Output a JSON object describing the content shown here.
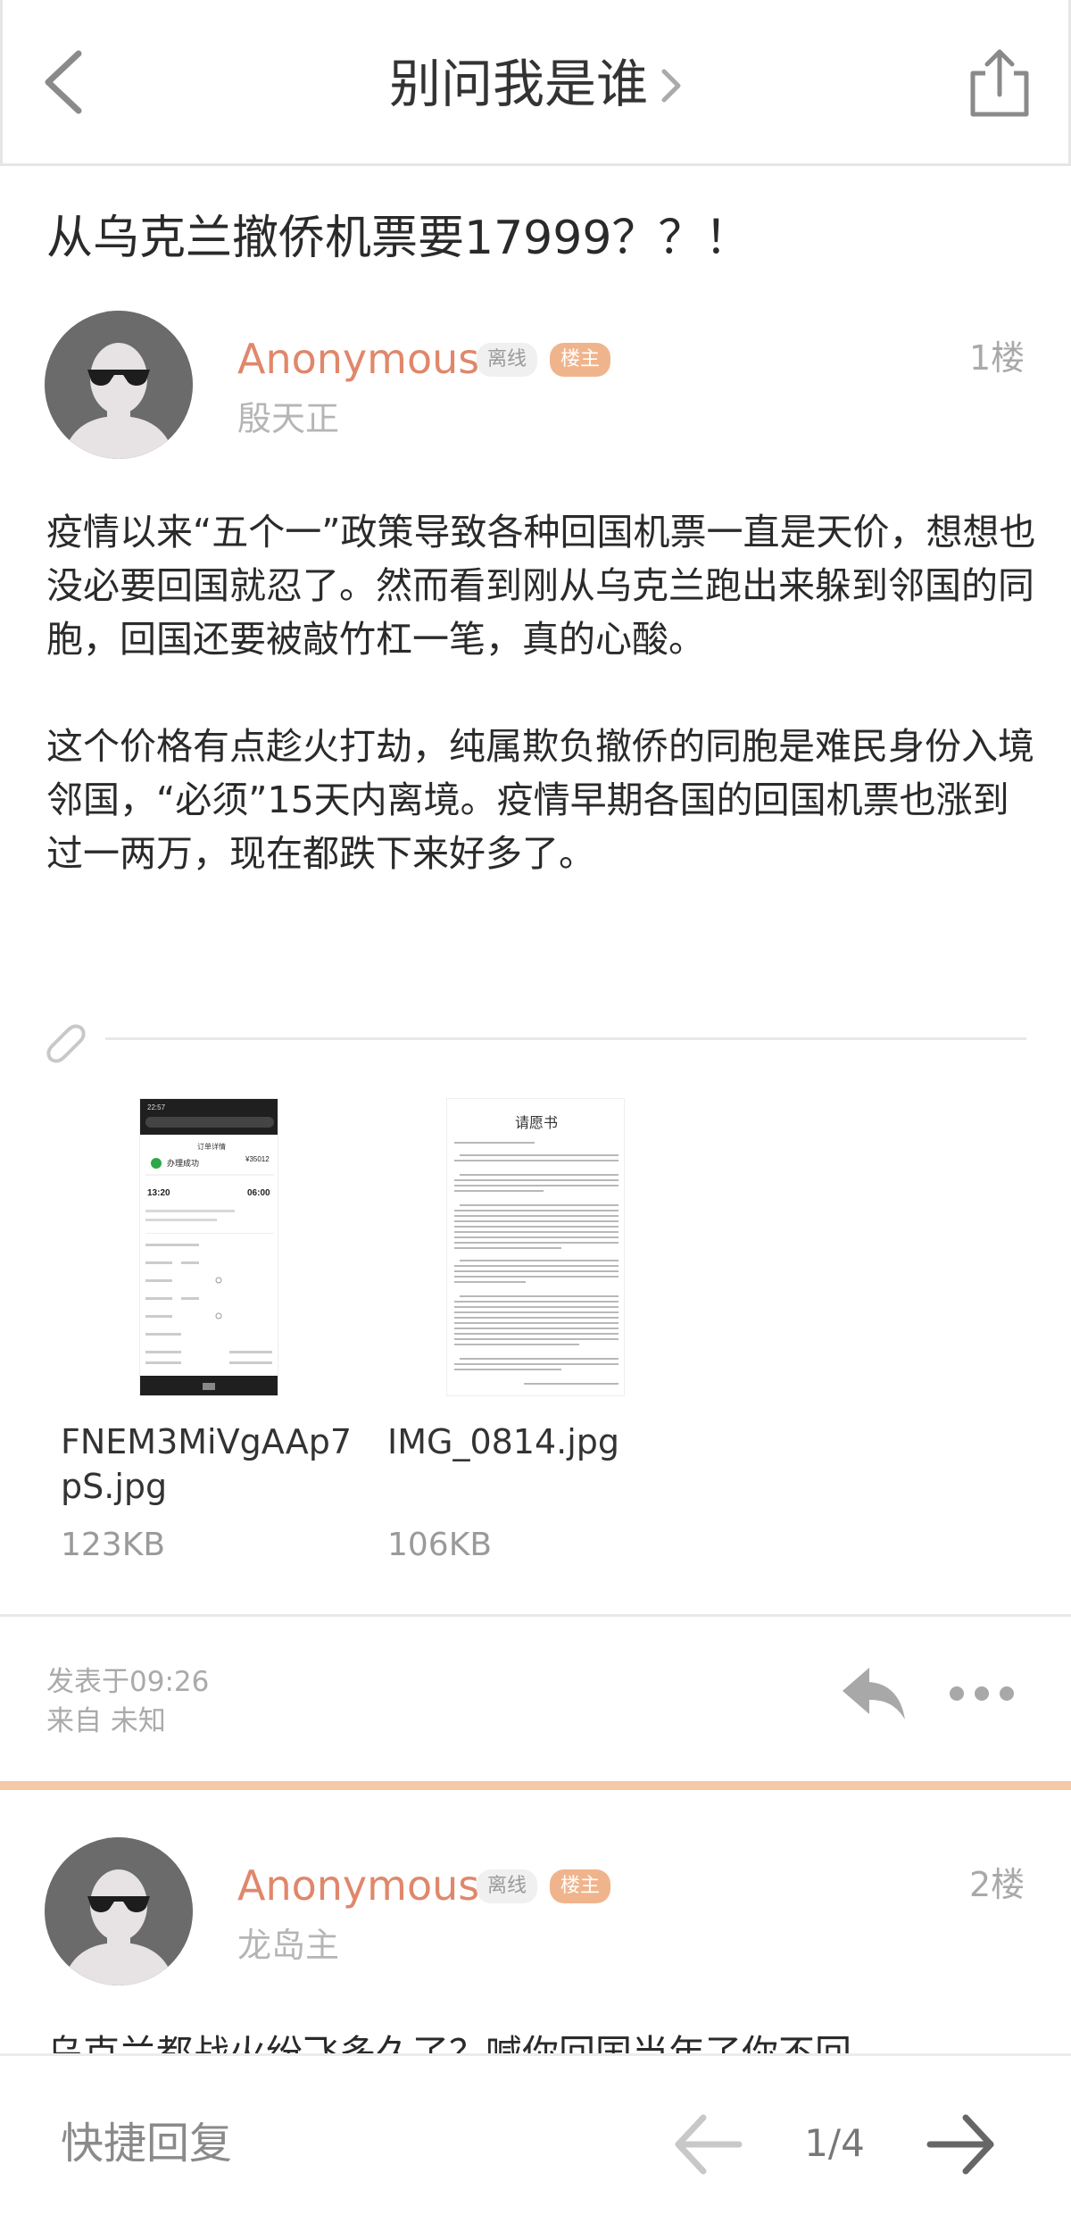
{
  "header": {
    "forum_name": "别问我是谁",
    "back_icon": "back-arrow-icon",
    "share_icon": "share-icon"
  },
  "thread": {
    "title": "从乌克兰撤侨机票要17999？？！"
  },
  "posts": [
    {
      "username": "Anonymous",
      "status": "离线",
      "role": "楼主",
      "floor": "1楼",
      "nickname": "殷天正",
      "paragraphs": [
        "疫情以来“五个一”政策导致各种回国机票一直是天价，想想也没必要回国就忍了。然而看到刚从乌克兰跑出来躲到邻国的同胞，回国还要被敲竹杠一笔，真的心酸。",
        "这个价格有点趁火打劫，纯属欺负撤侨的同胞是难民身份入境邻国，“必须”15天内离境。疫情早期各国的回国机票也涨到过一两万，现在都跌下来好多了。"
      ],
      "attachments": [
        {
          "name_line1": "FNEM3MiVgAAp7",
          "name_line2": "pS.jpg",
          "size": "123KB",
          "thumb": {
            "time": "22:57",
            "header": "订单详情",
            "status": "办理成功",
            "price": "¥35012",
            "dep": "13:20",
            "arr": "06:00"
          }
        },
        {
          "name_line1": "IMG_0814.jpg",
          "name_line2": "",
          "size": "106KB",
          "thumb": {
            "doc_title": "请愿书"
          }
        }
      ],
      "posted_at": "发表于09:26",
      "source": "来自 未知"
    },
    {
      "username": "Anonymous",
      "status": "离线",
      "role": "楼主",
      "floor": "2楼",
      "nickname": "龙岛主",
      "preview": "乌克兰都战火纷飞多久了？喊你回国当年了你不回"
    }
  ],
  "bottom": {
    "quick_reply": "快捷回复",
    "page_indicator": "1/4"
  },
  "colors": {
    "accent": "#e0876b",
    "owner_tag": "#f0b48c",
    "separator": "#f5c8a8"
  }
}
